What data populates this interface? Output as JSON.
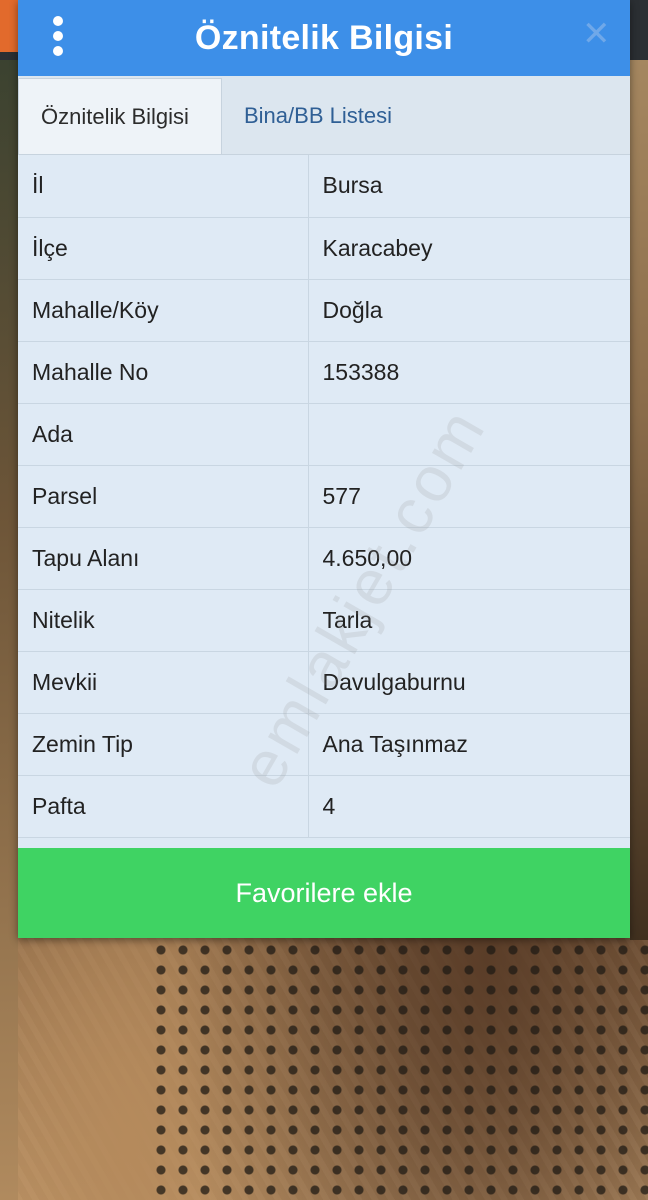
{
  "dialog": {
    "title": "Öznitelik Bilgisi",
    "menu_icon": "more-vertical-icon",
    "close_icon": "close-icon"
  },
  "tabs": [
    {
      "label": "Öznitelik Bilgisi",
      "active": true
    },
    {
      "label": "Bina/BB Listesi",
      "active": false
    }
  ],
  "attributes": [
    {
      "key": "İl",
      "value": "Bursa"
    },
    {
      "key": "İlçe",
      "value": "Karacabey"
    },
    {
      "key": "Mahalle/Köy",
      "value": "Doğla"
    },
    {
      "key": "Mahalle No",
      "value": "153388"
    },
    {
      "key": "Ada",
      "value": ""
    },
    {
      "key": "Parsel",
      "value": "577"
    },
    {
      "key": "Tapu Alanı",
      "value": "4.650,00"
    },
    {
      "key": "Nitelik",
      "value": "Tarla"
    },
    {
      "key": "Mevkii",
      "value": "Davulgaburnu"
    },
    {
      "key": "Zemin Tip",
      "value": "Ana Taşınmaz"
    },
    {
      "key": "Pafta",
      "value": "4"
    }
  ],
  "favorite_button": "Favorilere ekle",
  "watermark": "emlakjet.com",
  "colors": {
    "header": "#3d8fe8",
    "favorite_button": "#3fd363",
    "table_bg": "#dfeaf5"
  }
}
